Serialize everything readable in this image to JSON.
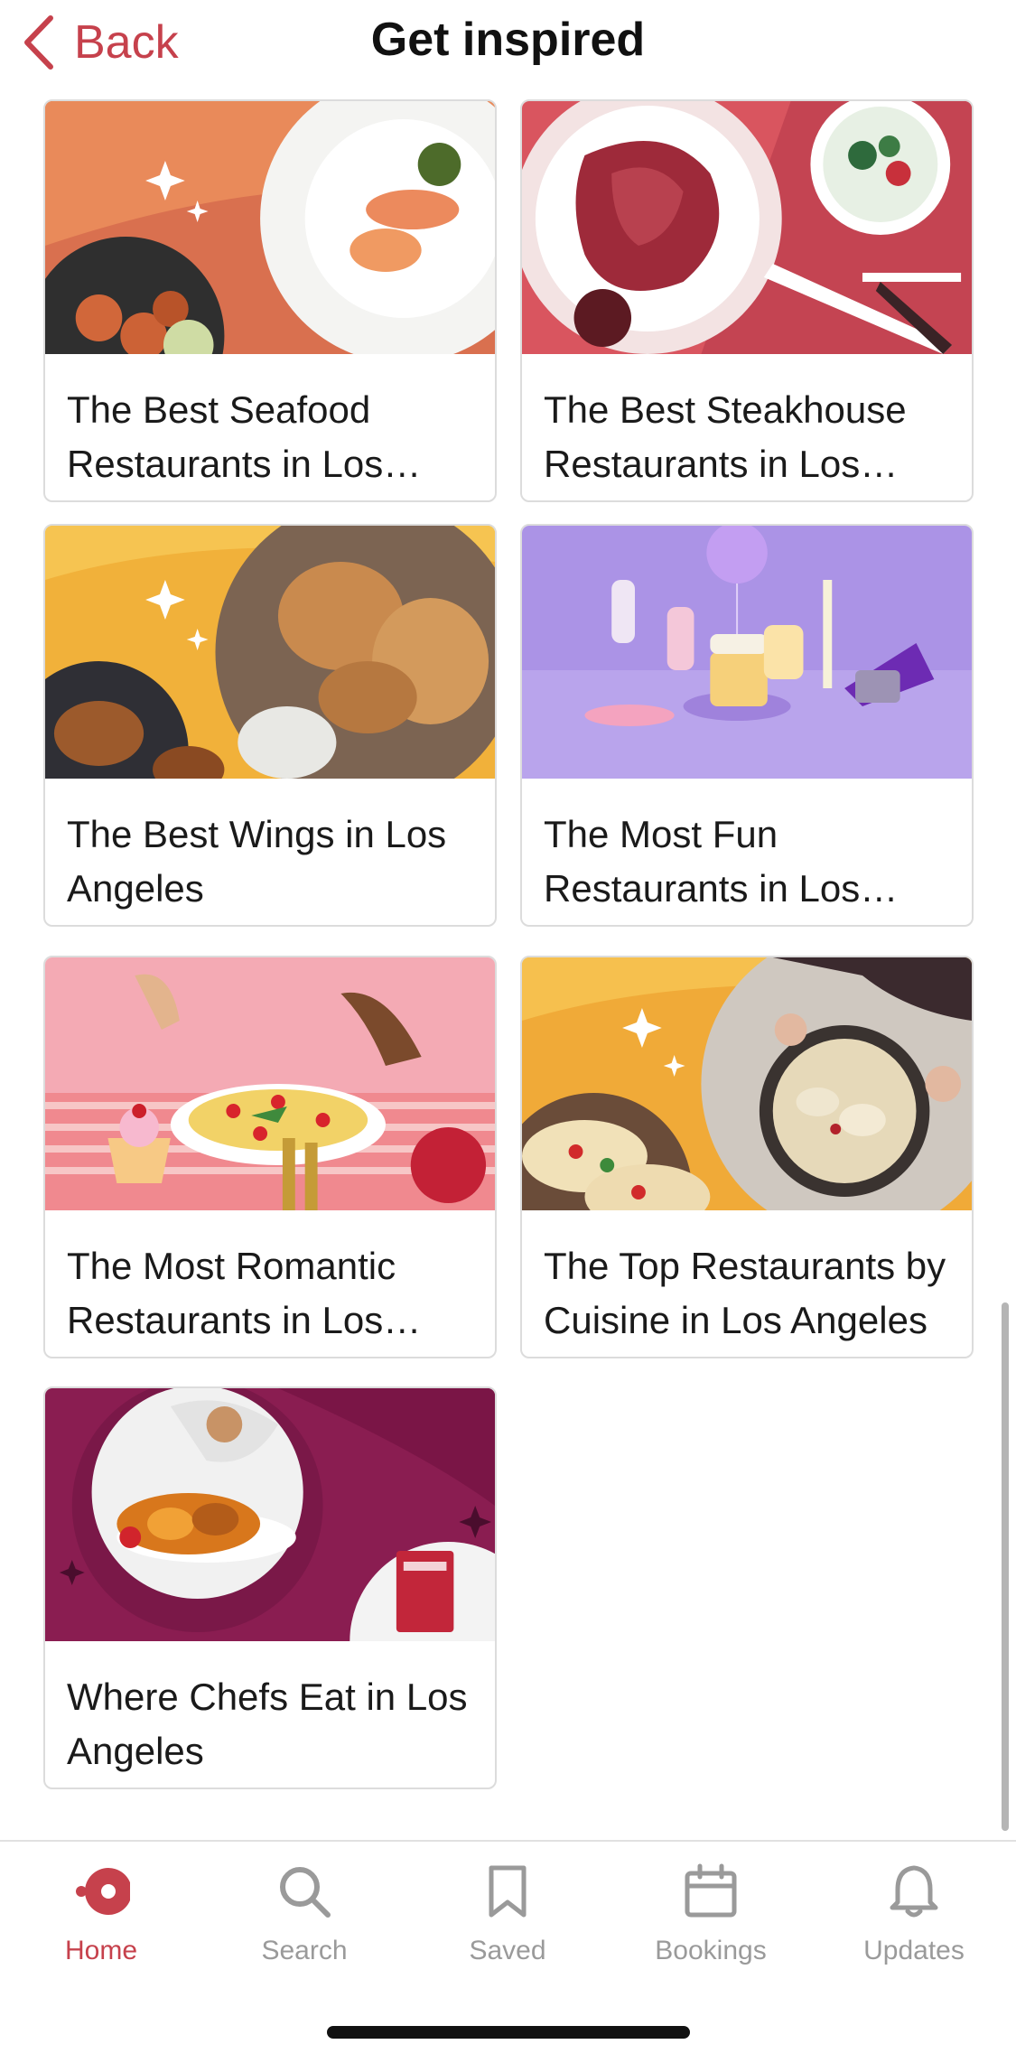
{
  "header": {
    "back_label": "Back",
    "title": "Get inspired"
  },
  "cards": [
    {
      "label": "The Best Seafood Restaurants in Los Angeles"
    },
    {
      "label": "The Best Steakhouse Restaurants in Los Angeles"
    },
    {
      "label": "The Best Wings in Los Angeles"
    },
    {
      "label": "The Most Fun Restaurants in Los Angeles"
    },
    {
      "label": "The Most Romantic Restaurants in Los Angeles"
    },
    {
      "label": "The Top Restaurants by Cuisine in Los Angeles"
    },
    {
      "label": "Where Chefs Eat in Los Angeles"
    }
  ],
  "tabs": [
    {
      "label": "Home",
      "icon": "home-icon",
      "active": true
    },
    {
      "label": "Search",
      "icon": "search-icon"
    },
    {
      "label": "Saved",
      "icon": "bookmark-icon"
    },
    {
      "label": "Bookings",
      "icon": "calendar-icon"
    },
    {
      "label": "Updates",
      "icon": "bell-icon"
    }
  ],
  "colors": {
    "accent": "#c6414c",
    "inactive": "#9a9a9a",
    "border": "#dcdcdc"
  }
}
